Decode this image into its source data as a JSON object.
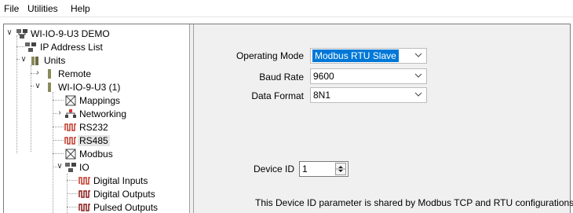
{
  "menu": {
    "file": "File",
    "utilities": "Utilities",
    "help": "Help"
  },
  "tree": {
    "root": "WI-IO-9-U3 DEMO",
    "ip_address_list": "IP Address List",
    "units": "Units",
    "remote": "Remote",
    "unit1": "WI-IO-9-U3 (1)",
    "mappings": "Mappings",
    "networking": "Networking",
    "rs232": "RS232",
    "rs485": "RS485",
    "modbus": "Modbus",
    "io": "IO",
    "digital_inputs": "Digital Inputs",
    "digital_outputs": "Digital Outputs",
    "pulsed_outputs": "Pulsed Outputs"
  },
  "form": {
    "operating_mode_label": "Operating Mode",
    "operating_mode_value": "Modbus RTU Slave",
    "baud_rate_label": "Baud Rate",
    "baud_rate_value": "9600",
    "data_format_label": "Data Format",
    "data_format_value": "8N1",
    "device_id_label": "Device ID",
    "device_id_value": "1",
    "note": "This Device ID parameter is shared by Modbus TCP and RTU configurations"
  },
  "colors": {
    "selection": "#0078d7",
    "panel_bg": "#f0f0f0",
    "tree_bg": "#ffffff"
  }
}
